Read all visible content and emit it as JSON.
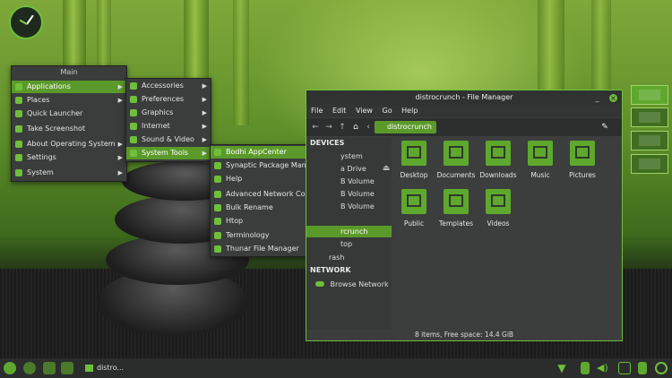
{
  "main_menu": {
    "title": "Main",
    "items": [
      {
        "label": "Applications"
      },
      {
        "label": "Places"
      },
      {
        "label": "Quick Launcher"
      },
      {
        "label": "Take Screenshot"
      },
      {
        "label": "About Operating System"
      },
      {
        "label": "Settings"
      },
      {
        "label": "System"
      }
    ]
  },
  "apps_menu": {
    "items": [
      {
        "label": "Accessories"
      },
      {
        "label": "Preferences"
      },
      {
        "label": "Graphics"
      },
      {
        "label": "Internet"
      },
      {
        "label": "Sound & Video"
      },
      {
        "label": "System Tools"
      }
    ]
  },
  "tools_menu": {
    "items": [
      {
        "label": "Bodhi AppCenter"
      },
      {
        "label": "Synaptic Package Manager"
      },
      {
        "label": "Help"
      },
      {
        "label": "Advanced Network Configuration"
      },
      {
        "label": "Bulk Rename"
      },
      {
        "label": "Htop"
      },
      {
        "label": "Terminology"
      },
      {
        "label": "Thunar File Manager"
      }
    ]
  },
  "file_manager": {
    "title": "distrocrunch - File Manager",
    "menubar": [
      "File",
      "Edit",
      "View",
      "Go",
      "Help"
    ],
    "path": "distrocrunch",
    "sidebar": {
      "devices_header": "DEVICES",
      "devices": [
        "ystem",
        "a Drive",
        "B Volume",
        "B Volume",
        "B Volume"
      ],
      "places": [
        "rcrunch",
        "top",
        "rash"
      ],
      "network_header": "NETWORK",
      "network": [
        "Browse Network"
      ]
    },
    "folders": [
      {
        "label": "Desktop"
      },
      {
        "label": "Documents"
      },
      {
        "label": "Downloads"
      },
      {
        "label": "Music"
      },
      {
        "label": "Pictures"
      },
      {
        "label": "Public"
      },
      {
        "label": "Templates"
      },
      {
        "label": "Videos"
      }
    ],
    "status": "8 items, Free space: 14.4 GiB"
  },
  "taskbar": {
    "task_label": "distro..."
  },
  "colors": {
    "accent": "#5b9a2a",
    "panel": "#2a2d2c",
    "menu_bg": "#3a3d3c"
  }
}
